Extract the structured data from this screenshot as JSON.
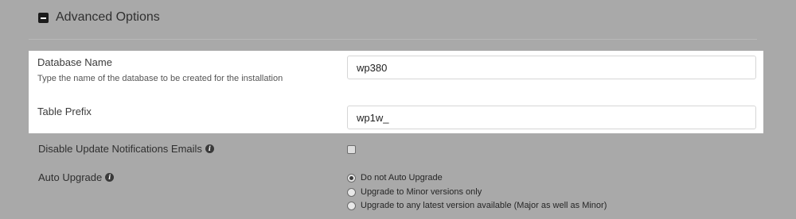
{
  "section": {
    "title": "Advanced Options",
    "toggle_icon": "collapse-minus-icon"
  },
  "fields": {
    "database_name": {
      "label": "Database Name",
      "help": "Type the name of the database to be created for the installation",
      "value": "wp380"
    },
    "table_prefix": {
      "label": "Table Prefix",
      "value": "wp1w_"
    }
  },
  "disable_update_notifications": {
    "label": "Disable Update Notifications Emails",
    "checked": false
  },
  "auto_upgrade": {
    "label": "Auto Upgrade",
    "options": [
      {
        "label": "Do not Auto Upgrade",
        "selected": true
      },
      {
        "label": "Upgrade to Minor versions only",
        "selected": false
      },
      {
        "label": "Upgrade to any latest version available (Major as well as Minor)",
        "selected": false
      }
    ]
  },
  "colors": {
    "background": "#a9a9a9",
    "highlight": "#ffffff"
  }
}
